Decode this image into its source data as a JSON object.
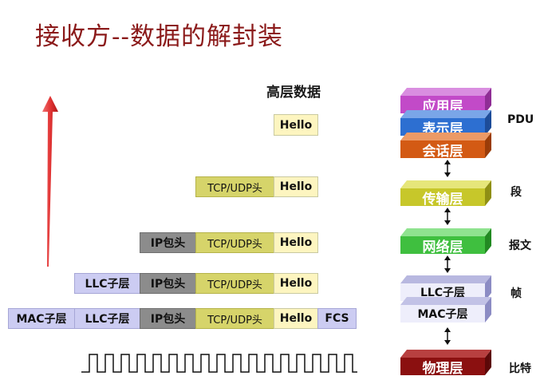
{
  "title": "接收方--数据的解封装",
  "upper_layer_label": "高层数据",
  "rows": {
    "hello_only": [
      "Hello"
    ],
    "transport": [
      "TCP/UDP头",
      "Hello"
    ],
    "network": [
      "IP包头",
      "TCP/UDP头",
      "Hello"
    ],
    "llc": [
      "LLC子层",
      "IP包头",
      "TCP/UDP头",
      "Hello"
    ],
    "mac": [
      "MAC子层",
      "LLC子层",
      "IP包头",
      "TCP/UDP头",
      "Hello",
      "FCS"
    ]
  },
  "layers": {
    "application": "应用层",
    "presentation": "表示层",
    "session": "会话层",
    "transport": "传输层",
    "network": "网络层",
    "llc": "LLC子层",
    "mac": "MAC子层",
    "physical": "物理层"
  },
  "pdu_labels": {
    "pdu": "PDU",
    "segment": "段",
    "packet": "报文",
    "frame": "帧",
    "bit": "比特"
  },
  "colors": {
    "title": "#8b1a1a",
    "arrow": "#e23434",
    "application": "#c24ac8",
    "presentation": "#2d6fd1",
    "session": "#d35a14",
    "transport": "#c7c72a",
    "network": "#3fbf3f",
    "llc_mac": "#d9d9f4",
    "physical": "#8b1010"
  }
}
